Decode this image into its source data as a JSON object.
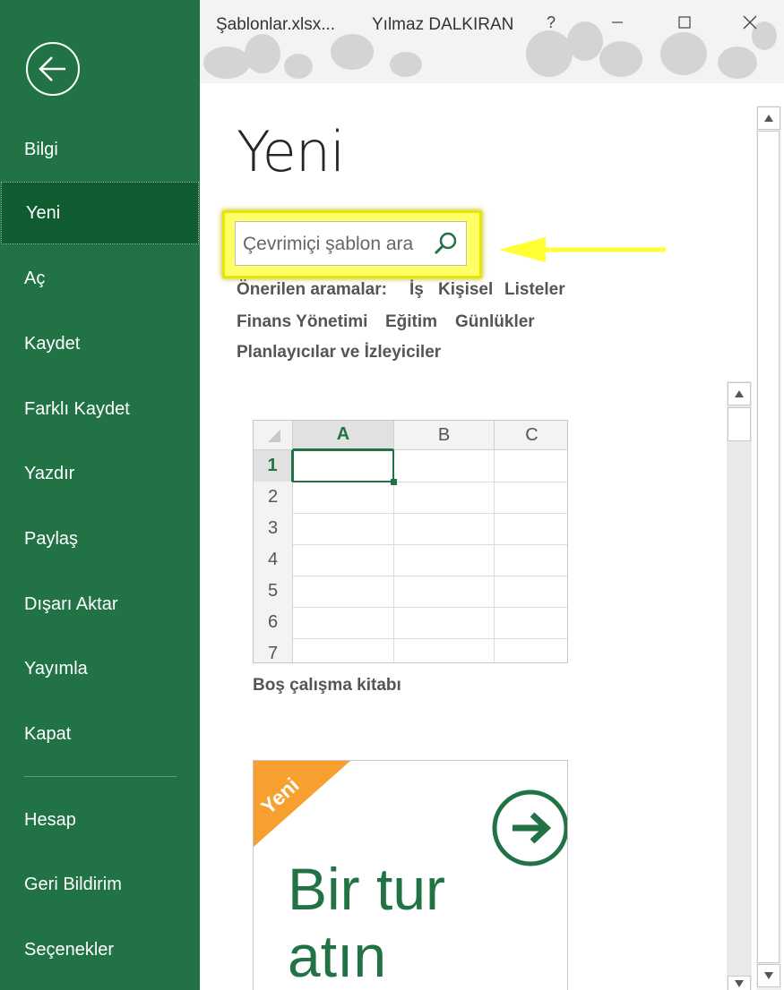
{
  "window": {
    "file_name": "Şablonlar.xlsx...",
    "user_name": "Yılmaz DALKIRAN",
    "help_label": "?"
  },
  "sidebar": {
    "items": [
      {
        "label": "Bilgi"
      },
      {
        "label": "Yeni",
        "active": true
      },
      {
        "label": "Aç"
      },
      {
        "label": "Kaydet"
      },
      {
        "label": "Farklı Kaydet"
      },
      {
        "label": "Yazdır"
      },
      {
        "label": "Paylaş"
      },
      {
        "label": "Dışarı Aktar"
      },
      {
        "label": "Yayımla"
      },
      {
        "label": "Kapat"
      },
      {
        "label": "Hesap"
      },
      {
        "label": "Geri Bildirim"
      },
      {
        "label": "Seçenekler"
      }
    ]
  },
  "main": {
    "title": "Yeni",
    "search": {
      "placeholder": "Çevrimiçi şablon ara"
    },
    "suggested": {
      "label": "Önerilen aramalar:",
      "items": [
        "İş",
        "Kişisel",
        "Listeler",
        "Finans Yönetimi",
        "Eğitim",
        "Günlükler",
        "Planlayıcılar ve İzleyiciler"
      ]
    },
    "templates": [
      {
        "name": "Boş çalışma kitabı",
        "columns": [
          "A",
          "B",
          "C"
        ],
        "rows": [
          "1",
          "2",
          "3",
          "4",
          "5",
          "6",
          "7"
        ]
      },
      {
        "badge": "Yeni",
        "title_lines": [
          "Bir tur",
          "atın"
        ]
      }
    ]
  },
  "colors": {
    "sidebar_bg": "#217346",
    "sidebar_active": "#0e5c30",
    "highlight": "#ffff66",
    "badge": "#f7a030",
    "accent_green": "#217346"
  }
}
